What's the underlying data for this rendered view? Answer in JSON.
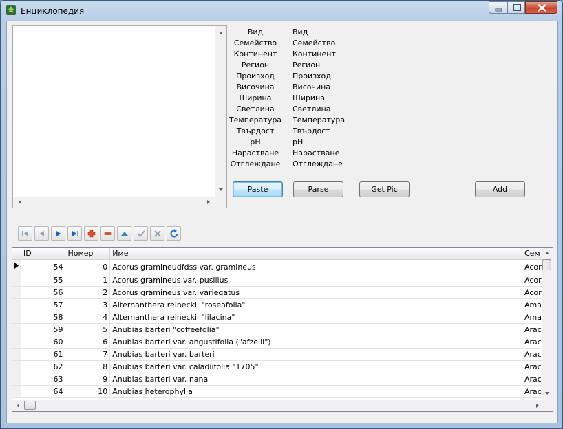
{
  "window": {
    "title": "Енциклопедия",
    "icon": "tree-app-icon",
    "controls": [
      "minimize-icon",
      "maximize-icon",
      "close-icon"
    ]
  },
  "memo": {
    "text": ""
  },
  "fields": {
    "labels": [
      "Вид",
      "Семейство",
      "Континент",
      "Регион",
      "Произход",
      "Височина",
      "Ширина",
      "Светлина",
      "Температура",
      "Твърдост",
      "pH",
      "Нарастване",
      "Отглеждане"
    ],
    "values": [
      "Вид",
      "Семейство",
      "Континент",
      "Регион",
      "Произход",
      "Височина",
      "Ширина",
      "Светлина",
      "Температура",
      "Твърдост",
      "pH",
      "Нарастване",
      "Отглеждане"
    ]
  },
  "buttons": {
    "paste": "Paste",
    "parse": "Parse",
    "get_pic": "Get Pic",
    "add": "Add"
  },
  "navigator": [
    "first-record-icon",
    "prior-record-icon",
    "next-record-icon",
    "last-record-icon",
    "insert-record-icon",
    "delete-record-icon",
    "edit-record-icon",
    "post-record-icon",
    "cancel-record-icon",
    "refresh-icon"
  ],
  "grid": {
    "headers": {
      "id": "ID",
      "number": "Номер",
      "name": "Име",
      "family": "Сем"
    },
    "rows": [
      {
        "id": "54",
        "number": "0",
        "name": "Acorus gramineudfdss var. gramineus",
        "family": "Acor"
      },
      {
        "id": "55",
        "number": "1",
        "name": "Acorus gramineus var. pusillus",
        "family": "Acor"
      },
      {
        "id": "56",
        "number": "2",
        "name": "Acorus gramineus var. variegatus",
        "family": "Acor"
      },
      {
        "id": "57",
        "number": "3",
        "name": "Alternanthera reineckii \"roseafolia\"",
        "family": "Ama"
      },
      {
        "id": "58",
        "number": "4",
        "name": "Alternanthera reineckii \"lilacina\"",
        "family": "Ama"
      },
      {
        "id": "59",
        "number": "5",
        "name": "Anubias barteri \"coffeefolia\"",
        "family": "Arac"
      },
      {
        "id": "60",
        "number": "6",
        "name": "Anubias barteri var. angustifolia (\"afzelii\")",
        "family": "Arac"
      },
      {
        "id": "61",
        "number": "7",
        "name": "Anubias barteri var. barteri",
        "family": "Arac"
      },
      {
        "id": "62",
        "number": "8",
        "name": "Anubias barteri var. caladiifolia \"1705\"",
        "family": "Arac"
      },
      {
        "id": "63",
        "number": "9",
        "name": "Anubias barteri var. nana",
        "family": "Arac"
      },
      {
        "id": "64",
        "number": "10",
        "name": "Anubias heterophylla",
        "family": "Arac"
      }
    ]
  }
}
